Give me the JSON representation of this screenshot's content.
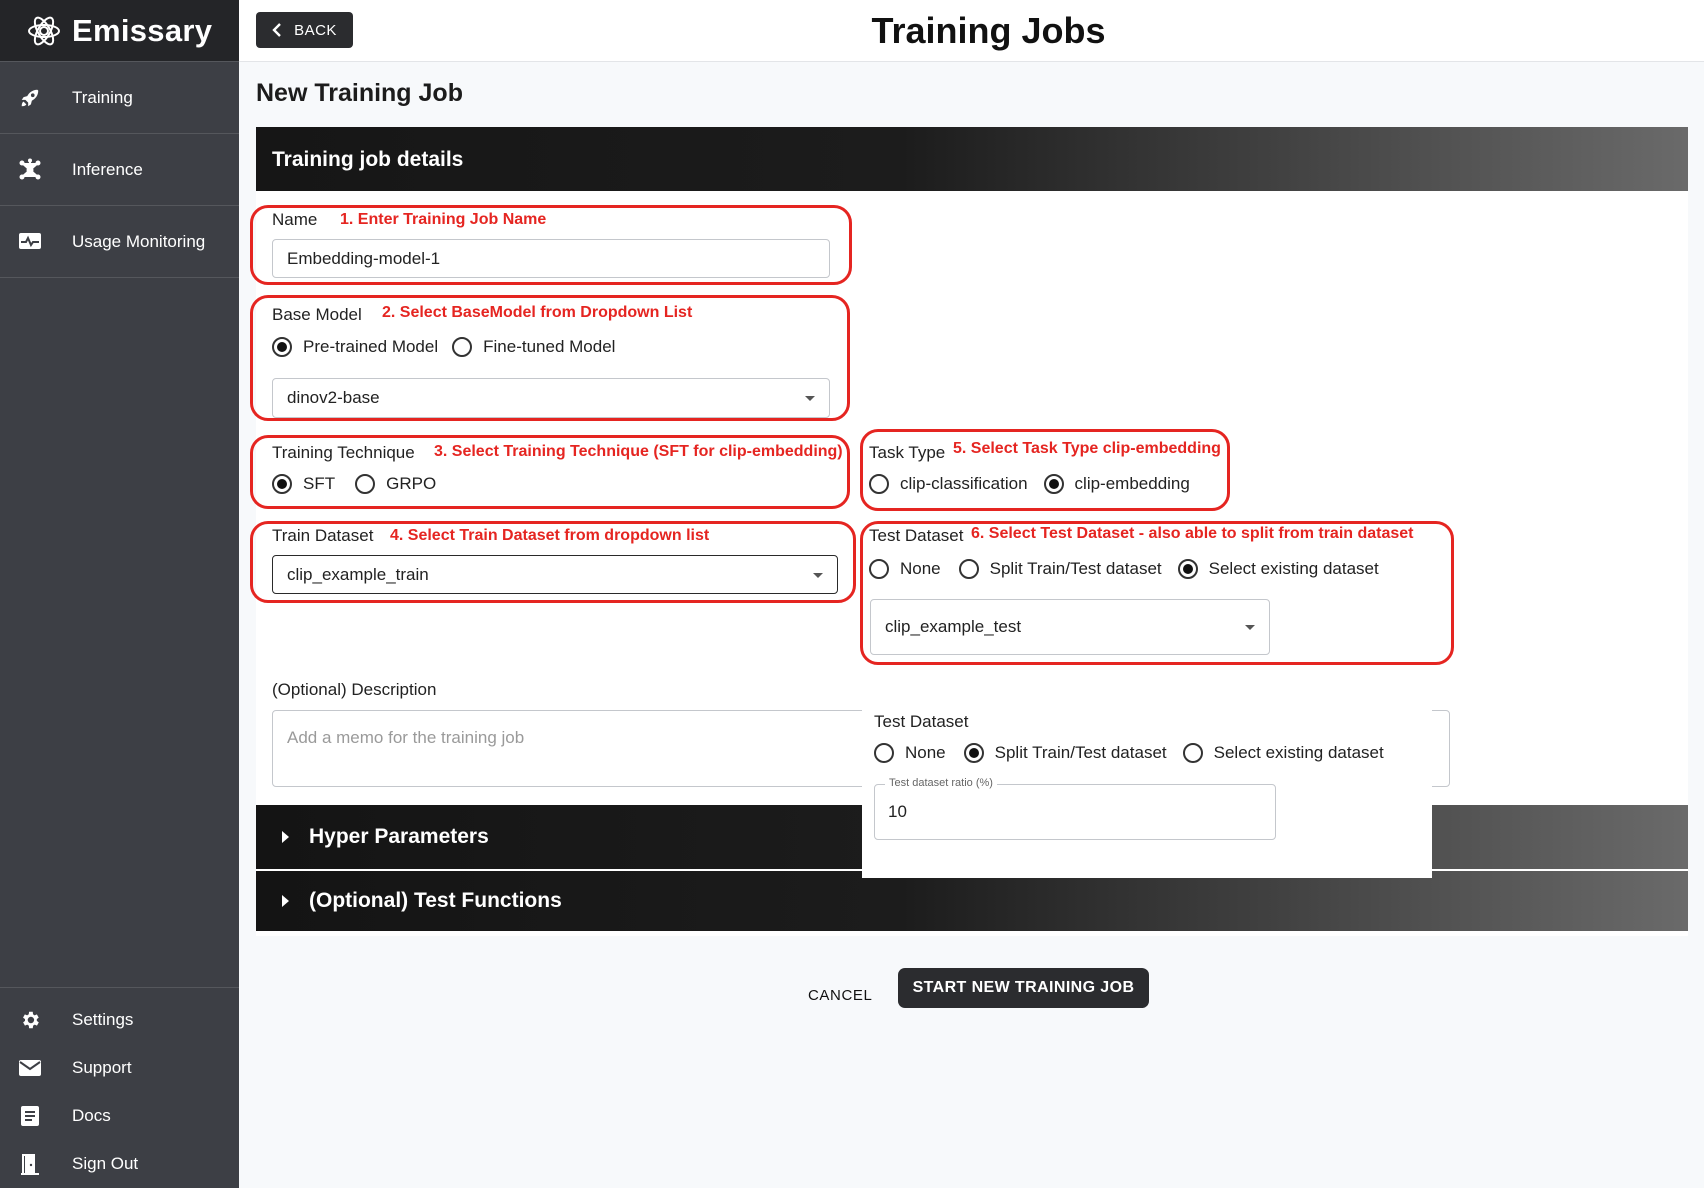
{
  "sidebar": {
    "brand": "Emissary",
    "nav_items": [
      {
        "label": "Training",
        "icon": "rocket-icon"
      },
      {
        "label": "Inference",
        "icon": "network-icon"
      },
      {
        "label": "Usage Monitoring",
        "icon": "monitor-pulse-icon"
      }
    ],
    "bottom_items": [
      {
        "label": "Settings",
        "icon": "gear-icon"
      },
      {
        "label": "Support",
        "icon": "mail-icon"
      },
      {
        "label": "Docs",
        "icon": "document-icon"
      },
      {
        "label": "Sign Out",
        "icon": "door-exit-icon"
      }
    ]
  },
  "header": {
    "back_label": "BACK",
    "title": "Training Jobs"
  },
  "page": {
    "title": "New Training Job"
  },
  "form": {
    "section_title": "Training job details",
    "name": {
      "label": "Name",
      "value": "Embedding-model-1"
    },
    "base_model": {
      "label": "Base Model",
      "options": [
        "Pre-trained Model",
        "Fine-tuned Model"
      ],
      "selected": "Pre-trained Model",
      "value": "dinov2-base"
    },
    "training_technique": {
      "label": "Training Technique",
      "options": [
        "SFT",
        "GRPO"
      ],
      "selected": "SFT"
    },
    "task_type": {
      "label": "Task Type",
      "options": [
        "clip-classification",
        "clip-embedding"
      ],
      "selected": "clip-embedding"
    },
    "train_dataset": {
      "label": "Train Dataset",
      "value": "clip_example_train"
    },
    "test_dataset": {
      "label": "Test Dataset",
      "options": [
        "None",
        "Split Train/Test dataset",
        "Select existing dataset"
      ],
      "selected": "Select existing dataset",
      "value": "clip_example_test"
    },
    "description": {
      "label": "(Optional) Description",
      "placeholder": "Add a memo for the training job"
    },
    "test_dataset_alt": {
      "label": "Test Dataset",
      "options": [
        "None",
        "Split Train/Test dataset",
        "Select existing dataset"
      ],
      "selected": "Split Train/Test dataset",
      "ratio_label": "Test dataset ratio (%)",
      "ratio_value": "10"
    },
    "accordions": [
      "Hyper Parameters",
      "(Optional) Test Functions"
    ]
  },
  "annotations": [
    "1. Enter Training Job Name",
    "2. Select BaseModel from Dropdown List",
    "3. Select Training Technique (SFT for clip-embedding)",
    "4. Select Train Dataset from dropdown list",
    "5. Select Task Type clip-embedding",
    "6. Select Test Dataset - also able to split from train dataset"
  ],
  "actions": {
    "cancel": "CANCEL",
    "start": "START NEW TRAINING JOB"
  },
  "colors": {
    "sidebar_bg": "#3d3f45",
    "brand_bg": "#242528",
    "annotation_red": "#e52521",
    "primary_dark": "#2b2c2f"
  }
}
